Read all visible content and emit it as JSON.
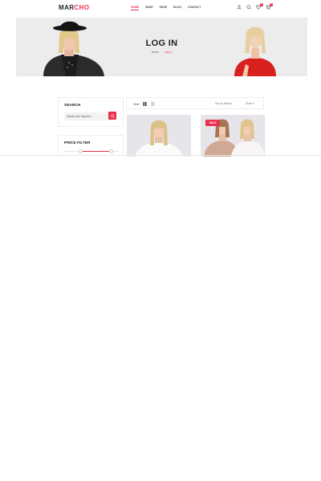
{
  "brand": {
    "logo_main": "MAR",
    "logo_accent": "CHO",
    "accent_color": "#e8314f"
  },
  "nav": [
    "HOME",
    "SHOP",
    "PAGE",
    "BLOG",
    "CONTACT"
  ],
  "header_icons": [
    {
      "icon": "user-icon"
    },
    {
      "icon": "search-icon"
    },
    {
      "icon": "heart-icon",
      "badge": "0"
    },
    {
      "icon": "cart-icon",
      "badge": "0"
    }
  ],
  "banner": {
    "title": "LOG IN",
    "breadcrumb_home": "Home",
    "breadcrumb_current": "Log In"
  },
  "sidebar": {
    "search_title": "SEARCH",
    "search_placeholder": "Search your keyword...",
    "price_title": "PRICE FILTER"
  },
  "toolbar": {
    "view_label": "View",
    "sort_label": "Sort by default",
    "show_label": "Show 9"
  },
  "products": [
    {
      "badge": ""
    },
    {
      "badge": "SALE"
    }
  ]
}
